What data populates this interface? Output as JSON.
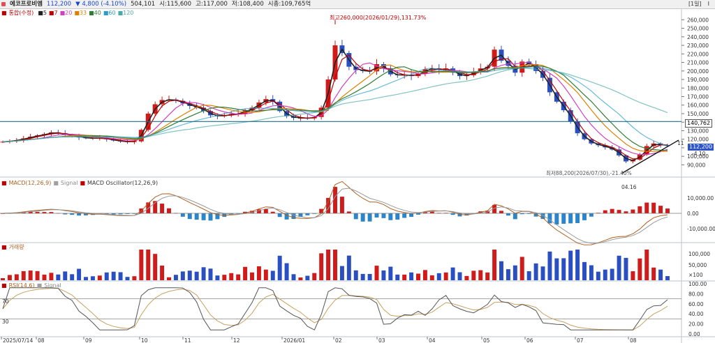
{
  "header": {
    "stock_name": "에코프로비엠",
    "price": "112,200",
    "change": "▼ 4,800 (-4.10%)",
    "volume": "504,101",
    "open": "시:115,600",
    "high": "고:117,000",
    "low": "저:108,400",
    "market_cap": "시총:109,765억",
    "period_label": "[1일]",
    "pin_label": "I"
  },
  "price_panel": {
    "legend_title": "통합(수정)",
    "ma_labels": [
      "5",
      "7",
      "20",
      "33",
      "40",
      "60",
      "120"
    ],
    "ma_colors": [
      "#222222",
      "#c00000",
      "#d040c0",
      "#e08000",
      "#2e7d32",
      "#2a9dc8",
      "#4aa8a8"
    ],
    "max_label": "최고260,000(2026/01/29),131.73%",
    "min_label": "최저88,200(2026/07/30),-21.40%",
    "min_date_label": "04.16",
    "line_label": "11",
    "yticks": [
      "260,000",
      "250,000",
      "240,000",
      "230,000",
      "220,000",
      "210,000",
      "200,000",
      "190,000",
      "180,000",
      "170,000",
      "160,000",
      "150,000",
      "140,000",
      "130,000",
      "120,000",
      "110,000",
      "100,000",
      "90,000"
    ],
    "ytick_values": [
      260000,
      250000,
      240000,
      230000,
      220000,
      210000,
      200000,
      190000,
      180000,
      170000,
      160000,
      150000,
      140000,
      130000,
      120000,
      110000,
      100000,
      90000
    ],
    "hline_tag": "140,762",
    "price_tag": "112,200",
    "change_tag": "-4,10"
  },
  "macd_panel": {
    "legend": [
      "MACD(12,26,9)",
      "Signal",
      "MACD Oscillator(12,26,9)"
    ],
    "yticks": [
      "10,000.00",
      "0.00",
      "-10,000.00"
    ],
    "ytick_values": [
      10000,
      0,
      -10000
    ]
  },
  "volume_panel": {
    "legend": "거래량",
    "yticks": [
      "100,000",
      "50,000",
      "×100"
    ]
  },
  "rsi_panel": {
    "legend": [
      "RSI(14,6)",
      "Signal"
    ],
    "yticks": [
      "100.00",
      "80.00",
      "60.00",
      "40.00",
      "20.00",
      "0.00"
    ],
    "ytick_values": [
      100,
      80,
      60,
      40,
      20,
      0
    ],
    "level_labels": [
      "70",
      "30"
    ]
  },
  "x_axis": {
    "labels": [
      "2025/07/14",
      "08",
      "09",
      "10",
      "11",
      "12",
      "2026/01",
      "02",
      "03",
      "04",
      "05",
      "06",
      "07",
      "08"
    ]
  },
  "chart_data": {
    "type": "line",
    "title": "",
    "series": [
      {
        "name": "Close",
        "values": [
          117000,
          118000,
          119000,
          121000,
          123000,
          124500,
          126000,
          128000,
          127000,
          125000,
          124500,
          122000,
          121500,
          121000,
          121500,
          120000,
          118500,
          117500,
          117000,
          117500,
          131000,
          150000,
          161000,
          166000,
          166500,
          165000,
          162000,
          159000,
          157000,
          153000,
          148000,
          147000,
          148000,
          149500,
          150000,
          154000,
          157000,
          163000,
          167000,
          164000,
          153000,
          147000,
          145000,
          145000,
          144500,
          146000,
          157000,
          190000,
          230000,
          221000,
          205000,
          201000,
          200000,
          199500,
          208000,
          203000,
          196000,
          195000,
          195500,
          194000,
          197000,
          202000,
          203000,
          201000,
          203000,
          198000,
          194000,
          195000,
          199000,
          203000,
          205000,
          225000,
          212000,
          206000,
          198000,
          211000,
          208000,
          200000,
          192000,
          175000,
          164000,
          154000,
          141000,
          127000,
          120000,
          115000,
          113000,
          110500,
          108000,
          101000,
          94000,
          96000,
          102000,
          112000,
          115000,
          113000,
          112200
        ]
      }
    ],
    "markers": {
      "max": {
        "value": 260000,
        "date": "2026/01/29",
        "pct": "131.73%"
      },
      "min": {
        "value": 88200,
        "date": "2026/07/30",
        "pct": "-21.40%"
      }
    },
    "ylim": [
      83000,
      266000
    ],
    "hline": 140762
  }
}
